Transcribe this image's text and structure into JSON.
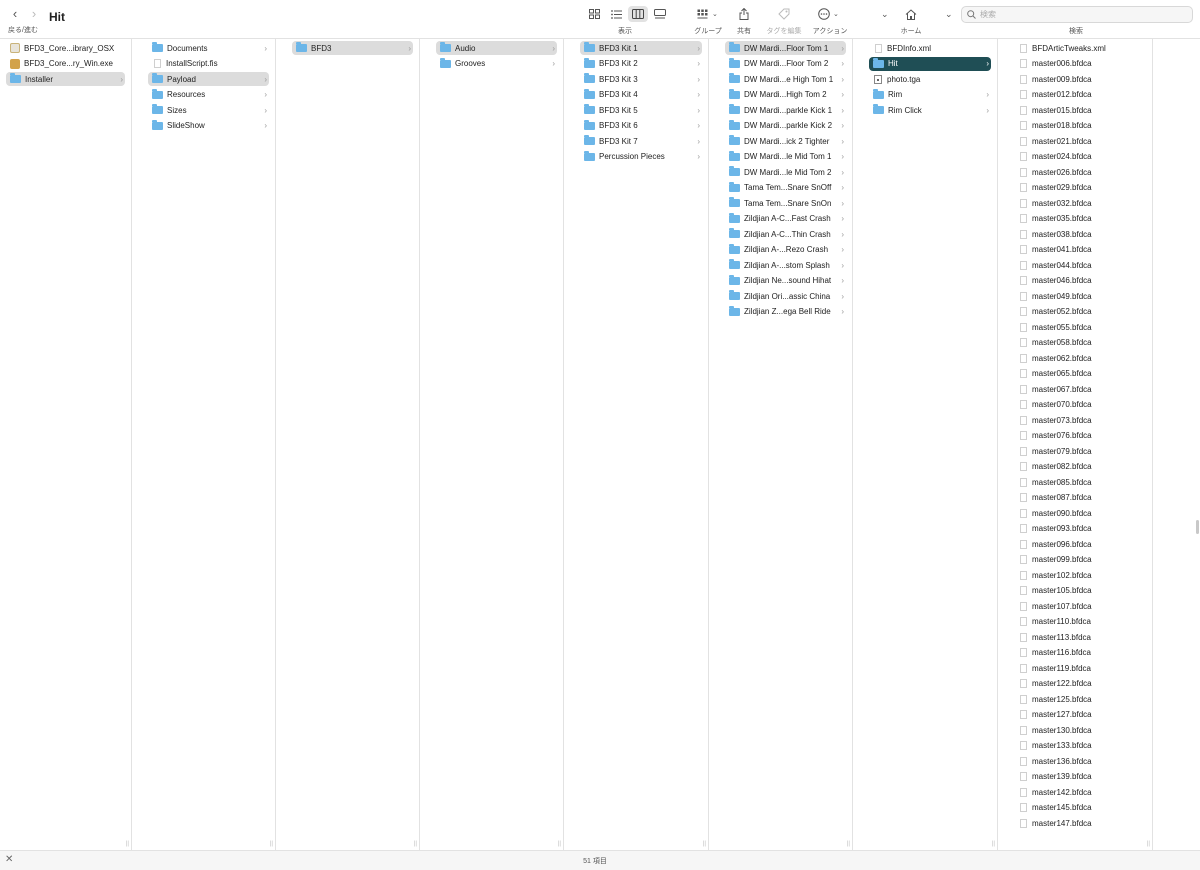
{
  "window": {
    "title": "Hit",
    "nav_label": "戻る/進む",
    "back_glyph": "‹",
    "forward_glyph": "›"
  },
  "toolbar": {
    "view_label": "表示",
    "group_label": "グループ",
    "share_label": "共有",
    "tags_label": "タグを編集",
    "action_label": "アクション",
    "home_label": "ホーム",
    "search_label": "検索",
    "search_placeholder": "検索",
    "active_view": "column",
    "icons": [
      "icon-view-icon",
      "list-view-icon",
      "column-view-icon",
      "gallery-view-icon",
      "group-icon",
      "share-icon",
      "tag-icon",
      "action-icon",
      "chevron-down-icon",
      "home-icon",
      "chevron-down-icon",
      "search-icon"
    ]
  },
  "columns": [
    {
      "items": [
        {
          "label": "BFD3_Core...ibrary_OSX",
          "icon": "osx-app-icon",
          "state": "normal",
          "has_children": false
        },
        {
          "label": "BFD3_Core...ry_Win.exe",
          "icon": "exe-icon",
          "state": "normal",
          "has_children": false
        },
        {
          "label": "Installer",
          "icon": "folder-icon",
          "state": "path",
          "has_children": true
        }
      ]
    },
    {
      "items": [
        {
          "label": "Documents",
          "icon": "folder-icon",
          "state": "normal",
          "has_children": true
        },
        {
          "label": "InstallScript.fis",
          "icon": "document-icon",
          "state": "normal",
          "has_children": false
        },
        {
          "label": "Payload",
          "icon": "folder-icon",
          "state": "path",
          "has_children": true
        },
        {
          "label": "Resources",
          "icon": "folder-icon",
          "state": "normal",
          "has_children": true
        },
        {
          "label": "Sizes",
          "icon": "folder-icon",
          "state": "normal",
          "has_children": true
        },
        {
          "label": "SlideShow",
          "icon": "folder-icon",
          "state": "normal",
          "has_children": true
        }
      ]
    },
    {
      "items": [
        {
          "label": "BFD3",
          "icon": "folder-icon",
          "state": "path",
          "has_children": true
        }
      ]
    },
    {
      "items": [
        {
          "label": "Audio",
          "icon": "folder-icon",
          "state": "path",
          "has_children": true
        },
        {
          "label": "Grooves",
          "icon": "folder-icon",
          "state": "normal",
          "has_children": true
        }
      ]
    },
    {
      "items": [
        {
          "label": "BFD3 Kit 1",
          "icon": "folder-icon",
          "state": "path",
          "has_children": true
        },
        {
          "label": "BFD3 Kit 2",
          "icon": "folder-icon",
          "state": "normal",
          "has_children": true
        },
        {
          "label": "BFD3 Kit 3",
          "icon": "folder-icon",
          "state": "normal",
          "has_children": true
        },
        {
          "label": "BFD3 Kit 4",
          "icon": "folder-icon",
          "state": "normal",
          "has_children": true
        },
        {
          "label": "BFD3 Kit 5",
          "icon": "folder-icon",
          "state": "normal",
          "has_children": true
        },
        {
          "label": "BFD3 Kit 6",
          "icon": "folder-icon",
          "state": "normal",
          "has_children": true
        },
        {
          "label": "BFD3 Kit 7",
          "icon": "folder-icon",
          "state": "normal",
          "has_children": true
        },
        {
          "label": "Percussion Pieces",
          "icon": "folder-icon",
          "state": "normal",
          "has_children": true
        }
      ]
    },
    {
      "items": [
        {
          "label": "DW Mardi...Floor Tom 1",
          "icon": "folder-icon",
          "state": "path",
          "has_children": true
        },
        {
          "label": "DW Mardi...Floor Tom 2",
          "icon": "folder-icon",
          "state": "normal",
          "has_children": true
        },
        {
          "label": "DW Mardi...e High Tom 1",
          "icon": "folder-icon",
          "state": "normal",
          "has_children": true
        },
        {
          "label": "DW Mardi...High Tom 2",
          "icon": "folder-icon",
          "state": "normal",
          "has_children": true
        },
        {
          "label": "DW Mardi...parkle Kick 1",
          "icon": "folder-icon",
          "state": "normal",
          "has_children": true
        },
        {
          "label": "DW Mardi...parkle Kick 2",
          "icon": "folder-icon",
          "state": "normal",
          "has_children": true
        },
        {
          "label": "DW Mardi...ick 2 Tighter",
          "icon": "folder-icon",
          "state": "normal",
          "has_children": true
        },
        {
          "label": "DW Mardi...le Mid Tom 1",
          "icon": "folder-icon",
          "state": "normal",
          "has_children": true
        },
        {
          "label": "DW Mardi...le Mid Tom 2",
          "icon": "folder-icon",
          "state": "normal",
          "has_children": true
        },
        {
          "label": "Tama Tem...Snare SnOff",
          "icon": "folder-icon",
          "state": "normal",
          "has_children": true
        },
        {
          "label": "Tama Tem...Snare SnOn",
          "icon": "folder-icon",
          "state": "normal",
          "has_children": true
        },
        {
          "label": "Zildjian A-C...Fast Crash",
          "icon": "folder-icon",
          "state": "normal",
          "has_children": true
        },
        {
          "label": "Zildjian A-C...Thin Crash",
          "icon": "folder-icon",
          "state": "normal",
          "has_children": true
        },
        {
          "label": "Zildjian A-...Rezo Crash",
          "icon": "folder-icon",
          "state": "normal",
          "has_children": true
        },
        {
          "label": "Zildjian A-...stom Splash",
          "icon": "folder-icon",
          "state": "normal",
          "has_children": true
        },
        {
          "label": "Zildjian Ne...sound Hihat",
          "icon": "folder-icon",
          "state": "normal",
          "has_children": true
        },
        {
          "label": "Zildjian Ori...assic China",
          "icon": "folder-icon",
          "state": "normal",
          "has_children": true
        },
        {
          "label": "Zildjian Z...ega Bell Ride",
          "icon": "folder-icon",
          "state": "normal",
          "has_children": true
        }
      ]
    },
    {
      "items": [
        {
          "label": "BFDInfo.xml",
          "icon": "document-icon",
          "state": "normal",
          "has_children": false
        },
        {
          "label": "Hit",
          "icon": "folder-icon",
          "state": "selected",
          "has_children": true
        },
        {
          "label": "photo.tga",
          "icon": "image-icon",
          "state": "normal",
          "has_children": false
        },
        {
          "label": "Rim",
          "icon": "folder-icon",
          "state": "normal",
          "has_children": true
        },
        {
          "label": "Rim Click",
          "icon": "folder-icon",
          "state": "normal",
          "has_children": true
        }
      ]
    },
    {
      "items": [
        {
          "label": "BFDArticTweaks.xml",
          "icon": "document-icon",
          "state": "normal",
          "has_children": false
        },
        {
          "label": "master006.bfdca",
          "icon": "document-icon",
          "state": "normal",
          "has_children": false
        },
        {
          "label": "master009.bfdca",
          "icon": "document-icon",
          "state": "normal",
          "has_children": false
        },
        {
          "label": "master012.bfdca",
          "icon": "document-icon",
          "state": "normal",
          "has_children": false
        },
        {
          "label": "master015.bfdca",
          "icon": "document-icon",
          "state": "normal",
          "has_children": false
        },
        {
          "label": "master018.bfdca",
          "icon": "document-icon",
          "state": "normal",
          "has_children": false
        },
        {
          "label": "master021.bfdca",
          "icon": "document-icon",
          "state": "normal",
          "has_children": false
        },
        {
          "label": "master024.bfdca",
          "icon": "document-icon",
          "state": "normal",
          "has_children": false
        },
        {
          "label": "master026.bfdca",
          "icon": "document-icon",
          "state": "normal",
          "has_children": false
        },
        {
          "label": "master029.bfdca",
          "icon": "document-icon",
          "state": "normal",
          "has_children": false
        },
        {
          "label": "master032.bfdca",
          "icon": "document-icon",
          "state": "normal",
          "has_children": false
        },
        {
          "label": "master035.bfdca",
          "icon": "document-icon",
          "state": "normal",
          "has_children": false
        },
        {
          "label": "master038.bfdca",
          "icon": "document-icon",
          "state": "normal",
          "has_children": false
        },
        {
          "label": "master041.bfdca",
          "icon": "document-icon",
          "state": "normal",
          "has_children": false
        },
        {
          "label": "master044.bfdca",
          "icon": "document-icon",
          "state": "normal",
          "has_children": false
        },
        {
          "label": "master046.bfdca",
          "icon": "document-icon",
          "state": "normal",
          "has_children": false
        },
        {
          "label": "master049.bfdca",
          "icon": "document-icon",
          "state": "normal",
          "has_children": false
        },
        {
          "label": "master052.bfdca",
          "icon": "document-icon",
          "state": "normal",
          "has_children": false
        },
        {
          "label": "master055.bfdca",
          "icon": "document-icon",
          "state": "normal",
          "has_children": false
        },
        {
          "label": "master058.bfdca",
          "icon": "document-icon",
          "state": "normal",
          "has_children": false
        },
        {
          "label": "master062.bfdca",
          "icon": "document-icon",
          "state": "normal",
          "has_children": false
        },
        {
          "label": "master065.bfdca",
          "icon": "document-icon",
          "state": "normal",
          "has_children": false
        },
        {
          "label": "master067.bfdca",
          "icon": "document-icon",
          "state": "normal",
          "has_children": false
        },
        {
          "label": "master070.bfdca",
          "icon": "document-icon",
          "state": "normal",
          "has_children": false
        },
        {
          "label": "master073.bfdca",
          "icon": "document-icon",
          "state": "normal",
          "has_children": false
        },
        {
          "label": "master076.bfdca",
          "icon": "document-icon",
          "state": "normal",
          "has_children": false
        },
        {
          "label": "master079.bfdca",
          "icon": "document-icon",
          "state": "normal",
          "has_children": false
        },
        {
          "label": "master082.bfdca",
          "icon": "document-icon",
          "state": "normal",
          "has_children": false
        },
        {
          "label": "master085.bfdca",
          "icon": "document-icon",
          "state": "normal",
          "has_children": false
        },
        {
          "label": "master087.bfdca",
          "icon": "document-icon",
          "state": "normal",
          "has_children": false
        },
        {
          "label": "master090.bfdca",
          "icon": "document-icon",
          "state": "normal",
          "has_children": false
        },
        {
          "label": "master093.bfdca",
          "icon": "document-icon",
          "state": "normal",
          "has_children": false
        },
        {
          "label": "master096.bfdca",
          "icon": "document-icon",
          "state": "normal",
          "has_children": false
        },
        {
          "label": "master099.bfdca",
          "icon": "document-icon",
          "state": "normal",
          "has_children": false
        },
        {
          "label": "master102.bfdca",
          "icon": "document-icon",
          "state": "normal",
          "has_children": false
        },
        {
          "label": "master105.bfdca",
          "icon": "document-icon",
          "state": "normal",
          "has_children": false
        },
        {
          "label": "master107.bfdca",
          "icon": "document-icon",
          "state": "normal",
          "has_children": false
        },
        {
          "label": "master110.bfdca",
          "icon": "document-icon",
          "state": "normal",
          "has_children": false
        },
        {
          "label": "master113.bfdca",
          "icon": "document-icon",
          "state": "normal",
          "has_children": false
        },
        {
          "label": "master116.bfdca",
          "icon": "document-icon",
          "state": "normal",
          "has_children": false
        },
        {
          "label": "master119.bfdca",
          "icon": "document-icon",
          "state": "normal",
          "has_children": false
        },
        {
          "label": "master122.bfdca",
          "icon": "document-icon",
          "state": "normal",
          "has_children": false
        },
        {
          "label": "master125.bfdca",
          "icon": "document-icon",
          "state": "normal",
          "has_children": false
        },
        {
          "label": "master127.bfdca",
          "icon": "document-icon",
          "state": "normal",
          "has_children": false
        },
        {
          "label": "master130.bfdca",
          "icon": "document-icon",
          "state": "normal",
          "has_children": false
        },
        {
          "label": "master133.bfdca",
          "icon": "document-icon",
          "state": "normal",
          "has_children": false
        },
        {
          "label": "master136.bfdca",
          "icon": "document-icon",
          "state": "normal",
          "has_children": false
        },
        {
          "label": "master139.bfdca",
          "icon": "document-icon",
          "state": "normal",
          "has_children": false
        },
        {
          "label": "master142.bfdca",
          "icon": "document-icon",
          "state": "normal",
          "has_children": false
        },
        {
          "label": "master145.bfdca",
          "icon": "document-icon",
          "state": "normal",
          "has_children": false
        },
        {
          "label": "master147.bfdca",
          "icon": "document-icon",
          "state": "normal",
          "has_children": false
        }
      ]
    }
  ],
  "statusbar": {
    "item_count": "51 項目"
  },
  "colors": {
    "selected_bg": "#1f4e55",
    "path_bg": "#dcdcdc",
    "folder": "#6cb6e8"
  }
}
